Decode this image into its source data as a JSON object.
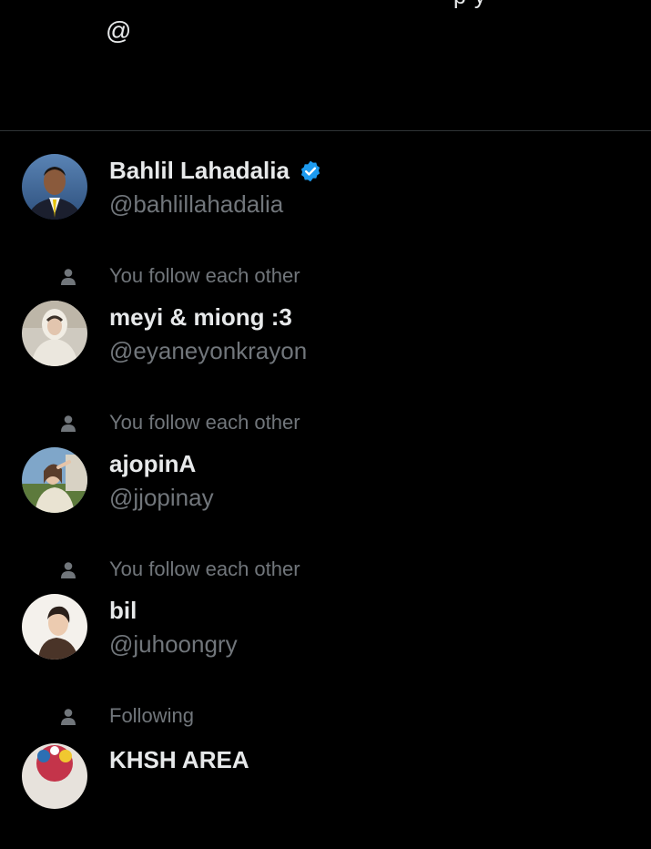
{
  "top": {
    "clipped_text": "p      y",
    "at_sign": "@"
  },
  "users": [
    {
      "context": "",
      "context_icon": "",
      "name": "Bahlil Lahadalia",
      "handle": "@bahlillahadalia",
      "verified": true,
      "avatar_icon": "avatar-man-suit"
    },
    {
      "context": "You follow each other",
      "context_icon": "person-icon",
      "name": "meyi & miong :3",
      "handle": "@eyaneyonkrayon",
      "verified": false,
      "avatar_icon": "avatar-person-white-hoodie"
    },
    {
      "context": "You follow each other",
      "context_icon": "person-icon",
      "name": "ajopinA",
      "handle": "@jjopinay",
      "verified": false,
      "avatar_icon": "avatar-person-outdoor"
    },
    {
      "context": "You follow each other",
      "context_icon": "person-icon",
      "name": "bil",
      "handle": "@juhoongry",
      "verified": false,
      "avatar_icon": "avatar-person-portrait"
    },
    {
      "context": "Following",
      "context_icon": "person-icon",
      "name": "KHSH AREA",
      "handle": "",
      "verified": false,
      "avatar_icon": "avatar-colorful"
    }
  ],
  "colors": {
    "background": "#000000",
    "primary_text": "#e7e9ea",
    "secondary_text": "#71767b",
    "divider": "#2f3336",
    "verified_blue": "#1d9bf0"
  }
}
